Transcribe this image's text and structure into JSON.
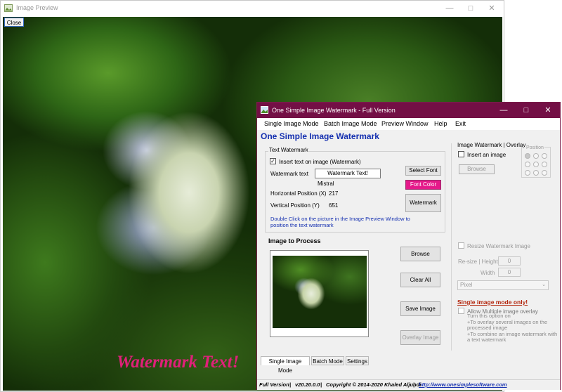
{
  "preview": {
    "title": "Image Preview",
    "close_label": "Close",
    "watermark_overlay": "Watermark Text!"
  },
  "main": {
    "title": "One Simple Image Watermark - Full Version",
    "menu": [
      "Single Image Mode",
      "Batch Image Mode",
      "Preview Window",
      "Help",
      "Exit"
    ],
    "heading": "One Simple Image Watermark"
  },
  "text_watermark": {
    "legend": "Text Watermark",
    "insert_text_label": "Insert text on image (Watermark)",
    "insert_checked": true,
    "watermark_text_label": "Watermark text",
    "watermark_text_value": "Watermark Text!",
    "font_name": "Mistral",
    "h_pos_label": "Horizontal Position (X)",
    "h_pos_value": "217",
    "v_pos_label": "Vertical Position (Y)",
    "v_pos_value": "651",
    "select_font_label": "Select Font",
    "font_color_label": "Font Color",
    "watermark_button": "Watermark",
    "hint": "Double Click on the picture in the Image Preview Window to position the text watermark"
  },
  "image_process": {
    "heading": "Image to Process",
    "browse": "Browse",
    "clear_all": "Clear All",
    "save_image": "Save Image",
    "overlay_image": "Overlay Image"
  },
  "tabs": [
    "Single Image Mode",
    "Batch Mode",
    "Settings"
  ],
  "image_watermark": {
    "legend": "Image Watermark | Overlay",
    "insert_image_label": "Insert an image",
    "browse": "Browse",
    "position_label": "Position",
    "resize_label": "Resize Watermark Image",
    "resize_height_label": "Re-size | Height",
    "height_value": "0",
    "width_label": "Width",
    "width_value": "0",
    "unit": "Pixel",
    "single_mode_only": "Single image mode only!",
    "allow_multi_label": "Allow Multiple image overlay",
    "multi_desc": "Turn this option on\n+To overlay several images on the processed image\n+To combine an image watermark with a text watermark"
  },
  "status": {
    "edition": "Full Version",
    "version": "v20.20.0.0",
    "copyright": "Copyright © 2014-2020 Khaled Aljundi",
    "url": "http://www.onesimplesoftware.com"
  },
  "colors": {
    "titlebar": "#730f45",
    "heading_blue": "#1530b0",
    "font_color_swatch": "#e5198a",
    "warning_red": "#b3260d"
  }
}
